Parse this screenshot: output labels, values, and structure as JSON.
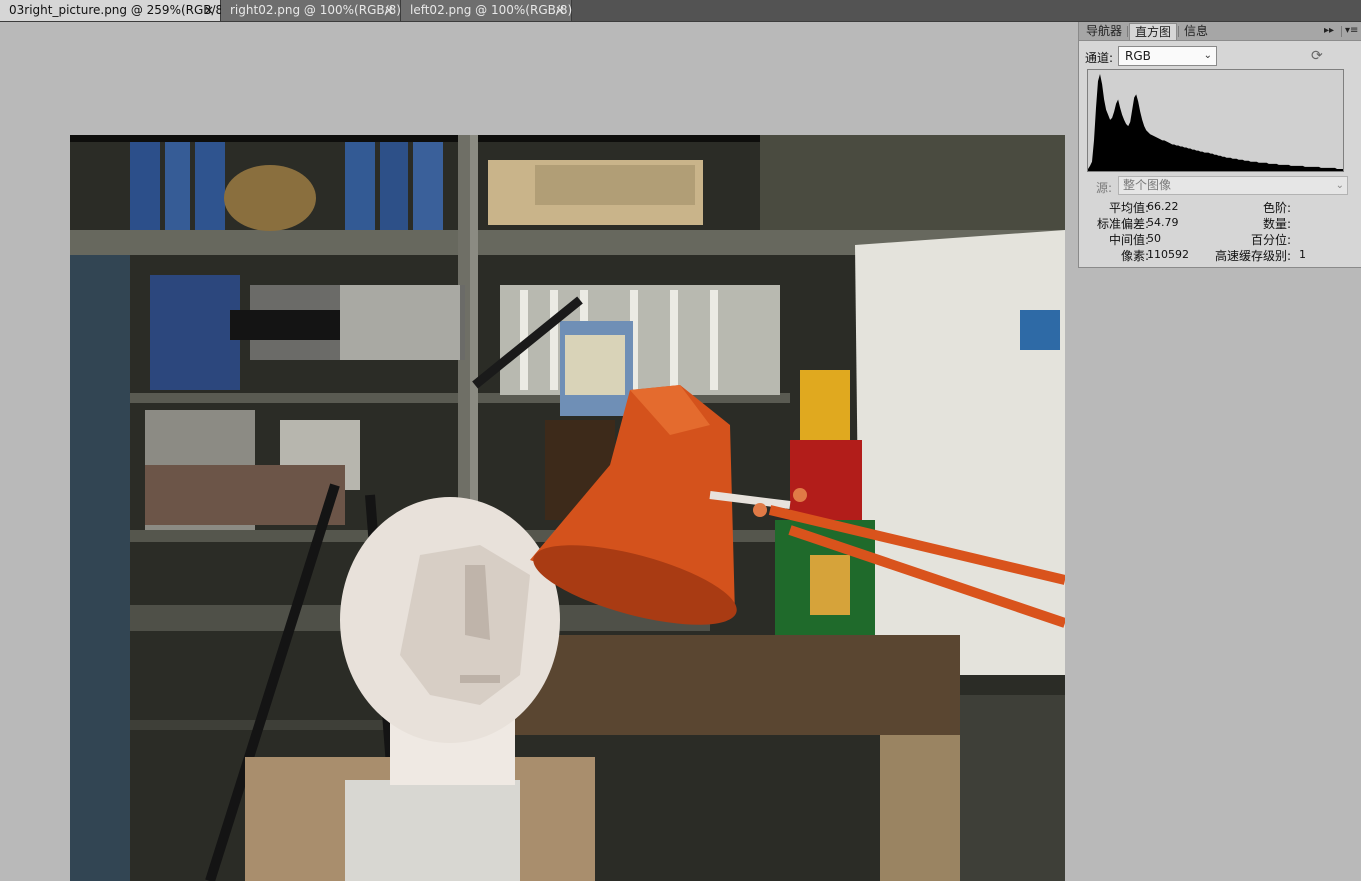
{
  "tabs": [
    {
      "label": "03right_picture.png @ 259%(RGB/8)",
      "active": true
    },
    {
      "label": "right02.png @ 100%(RGB/8)",
      "active": false
    },
    {
      "label": "left02.png @ 100%(RGB/8)",
      "active": false
    }
  ],
  "tab_close_glyph": "×",
  "panel": {
    "tabs": [
      "导航器",
      "直方图",
      "信息"
    ],
    "active_tab": "直方图",
    "channel_label": "通道:",
    "channel_value": "RGB",
    "source_label": "源:",
    "source_value": "整个图像",
    "stats": {
      "mean_label": "平均值:",
      "mean_value": "66.22",
      "std_label": "标准偏差:",
      "std_value": "54.79",
      "median_label": "中间值:",
      "median_value": "50",
      "pixels_label": "像素:",
      "pixels_value": "110592",
      "level_label": "色阶:",
      "level_value": "",
      "count_label": "数量:",
      "count_value": "",
      "percentile_label": "百分位:",
      "percentile_value": "",
      "cache_label": "高速缓存级别:",
      "cache_value": "1"
    },
    "icons": {
      "expand": "expand-icon",
      "menu": "panel-menu-icon",
      "refresh": "refresh-icon"
    }
  },
  "histogram_levels": [
    2,
    5,
    9,
    30,
    62,
    88,
    95,
    85,
    70,
    60,
    55,
    50,
    52,
    58,
    66,
    70,
    62,
    55,
    50,
    46,
    44,
    48,
    60,
    72,
    75,
    68,
    58,
    50,
    44,
    40,
    38,
    36,
    35,
    34,
    33,
    32,
    31,
    30,
    30,
    29,
    28,
    27,
    26,
    26,
    25,
    25,
    24,
    24,
    23,
    23,
    22,
    22,
    21,
    21,
    20,
    20,
    19,
    19,
    18,
    18,
    18,
    17,
    17,
    16,
    16,
    15,
    15,
    14,
    14,
    13,
    13,
    13,
    12,
    12,
    12,
    11,
    11,
    11,
    10,
    10,
    10,
    9,
    9,
    9,
    9,
    8,
    8,
    8,
    8,
    8,
    7,
    7,
    7,
    7,
    7,
    6,
    6,
    6,
    6,
    6,
    6,
    5,
    5,
    5,
    5,
    5,
    5,
    5,
    4,
    4,
    4,
    4,
    4,
    4,
    4,
    4,
    3,
    3,
    3,
    3,
    3,
    3,
    3,
    3,
    2,
    2,
    2,
    2
  ]
}
